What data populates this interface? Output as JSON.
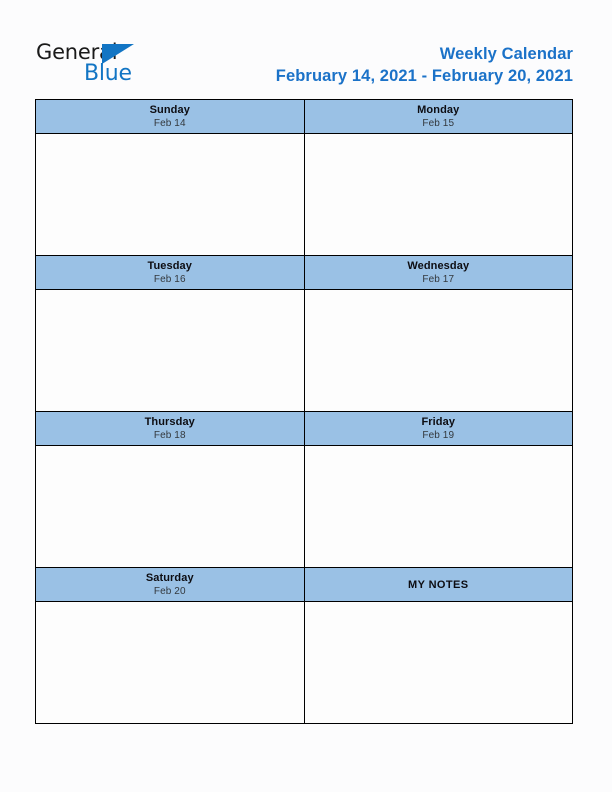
{
  "page": {
    "background_color": "#fcfcfd",
    "accent_blue": "#1b72c8",
    "header_fill": "#9ac1e5",
    "border_color": "#000000"
  },
  "logo": {
    "word_one": "General",
    "word_two": "Blue",
    "triangle_icon": "blue-right-triangle-icon"
  },
  "title": {
    "heading": "Weekly Calendar",
    "date_range": "February 14, 2021 - February 20, 2021"
  },
  "calendar": {
    "weeks": [
      {
        "cells": [
          {
            "day": "Sunday",
            "date": "Feb 14",
            "notes": ""
          },
          {
            "day": "Monday",
            "date": "Feb 15",
            "notes": ""
          }
        ]
      },
      {
        "cells": [
          {
            "day": "Tuesday",
            "date": "Feb 16",
            "notes": ""
          },
          {
            "day": "Wednesday",
            "date": "Feb 17",
            "notes": ""
          }
        ]
      },
      {
        "cells": [
          {
            "day": "Thursday",
            "date": "Feb 18",
            "notes": ""
          },
          {
            "day": "Friday",
            "date": "Feb 19",
            "notes": ""
          }
        ]
      },
      {
        "cells": [
          {
            "day": "Saturday",
            "date": "Feb 20",
            "notes": ""
          },
          {
            "day": "MY NOTES",
            "date": "",
            "notes": ""
          }
        ]
      }
    ]
  }
}
